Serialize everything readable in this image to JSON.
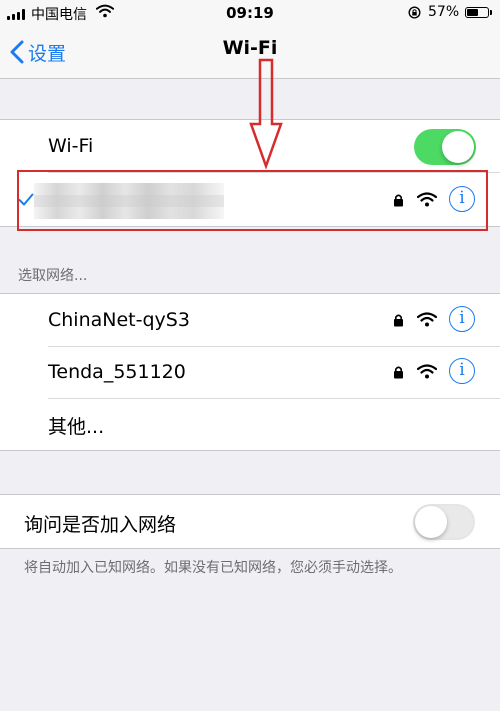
{
  "status_bar": {
    "carrier": "中国电信",
    "time": "09:19",
    "battery": "57%",
    "battery_level": 0.57
  },
  "nav": {
    "back_label": "设置",
    "title": "Wi-Fi"
  },
  "wifi_group": {
    "label": "Wi-Fi",
    "enabled": true,
    "connected_network": {
      "name": "",
      "secured": true
    }
  },
  "networks": {
    "section_label": "选取网络...",
    "items": [
      {
        "name": "ChinaNet-qyS3",
        "secured": true
      },
      {
        "name": "Tenda_551120",
        "secured": true
      }
    ],
    "other_label": "其他..."
  },
  "ask_join": {
    "label": "询问是否加入网络",
    "enabled": false,
    "note": "将自动加入已知网络。如果没有已知网络，您必须手动选择。"
  },
  "colors": {
    "accent": "#1a7cf0",
    "toggle_on": "#4cd964",
    "annotation": "#d62c2c"
  },
  "icons": [
    "signal-icon",
    "wifi-icon",
    "rotation-lock-icon",
    "battery-icon",
    "chevron-left-icon",
    "checkmark-icon",
    "lock-icon",
    "info-icon",
    "arrow-down-icon"
  ]
}
